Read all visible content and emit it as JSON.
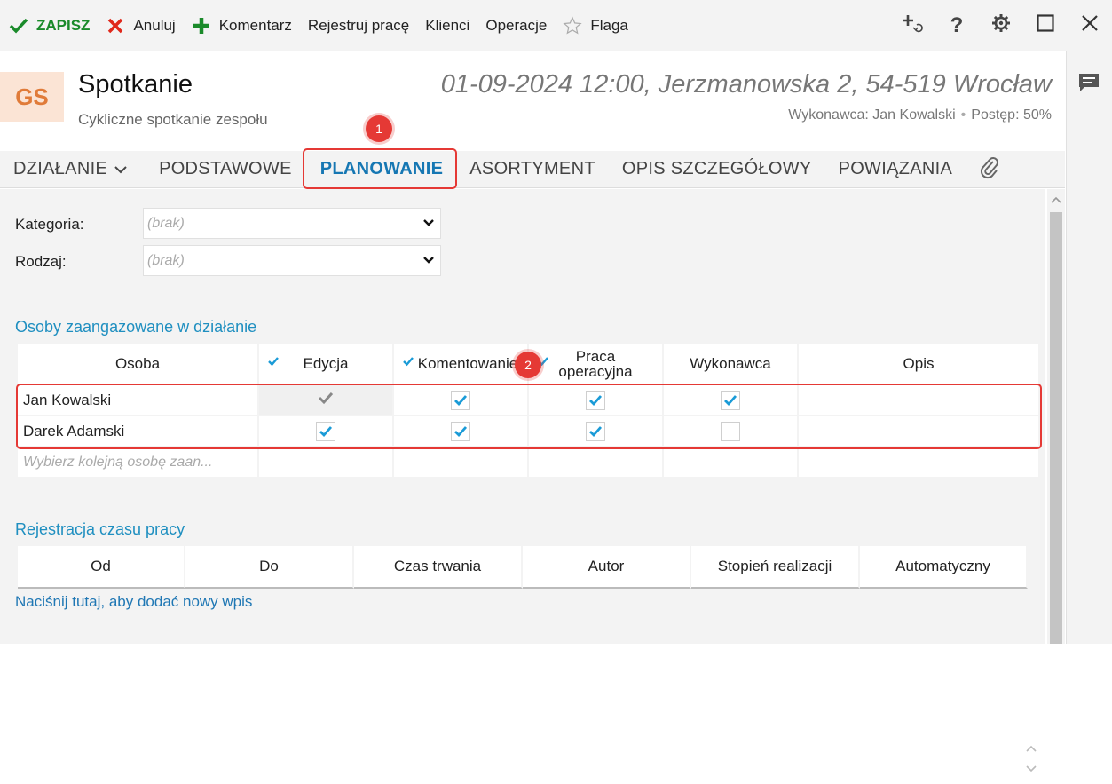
{
  "toolbar": {
    "save": "ZAPISZ",
    "cancel": "Anuluj",
    "comment": "Komentarz",
    "register_work": "Rejestruj pracę",
    "clients": "Klienci",
    "operations": "Operacje",
    "flag": "Flaga"
  },
  "header": {
    "avatar": "GS",
    "title": "Spotkanie",
    "subtitle": "Cykliczne spotkanie zespołu",
    "datetime_location": "01-09-2024 12:00, Jerzmanowska 2, 54-519 Wrocław",
    "executor": "Wykonawca: Jan Kowalski",
    "progress": "Postęp: 50%"
  },
  "tabs": [
    {
      "label": "DZIAŁANIE"
    },
    {
      "label": "PODSTAWOWE"
    },
    {
      "label": "PLANOWANIE",
      "active": true
    },
    {
      "label": "ASORTYMENT"
    },
    {
      "label": "OPIS SZCZEGÓŁOWY"
    },
    {
      "label": "POWIĄZANIA"
    }
  ],
  "annotations": {
    "badge1": "1",
    "badge2": "2"
  },
  "form": {
    "category_label": "Kategoria:",
    "category_value": "(brak)",
    "type_label": "Rodzaj:",
    "type_value": "(brak)"
  },
  "people": {
    "section_title": "Osoby zaangażowane w działanie",
    "columns": {
      "person": "Osoba",
      "edit": "Edycja",
      "comment": "Komentowanie",
      "operational_1": "Praca",
      "operational_2": "operacyjna",
      "executor": "Wykonawca",
      "description": "Opis"
    },
    "rows": [
      {
        "name": "Jan Kowalski",
        "edit": true,
        "edit_locked": true,
        "comment": true,
        "operational": true,
        "executor": true,
        "description": ""
      },
      {
        "name": "Darek Adamski",
        "edit": true,
        "edit_locked": false,
        "comment": true,
        "operational": true,
        "executor": false,
        "description": ""
      }
    ],
    "add_placeholder": "Wybierz kolejną osobę zaan..."
  },
  "time": {
    "section_title": "Rejestracja czasu pracy",
    "columns": {
      "from": "Od",
      "to": "Do",
      "duration": "Czas trwania",
      "author": "Autor",
      "completion": "Stopień realizacji",
      "automatic": "Automatyczny"
    },
    "add_link": "Naciśnij tutaj, aby dodać nowy wpis"
  },
  "colors": {
    "accent": "#1677b3",
    "section": "#1f8fc0",
    "check": "#1a9bd7",
    "highlight": "#e53935",
    "save": "#1a8a2a"
  }
}
